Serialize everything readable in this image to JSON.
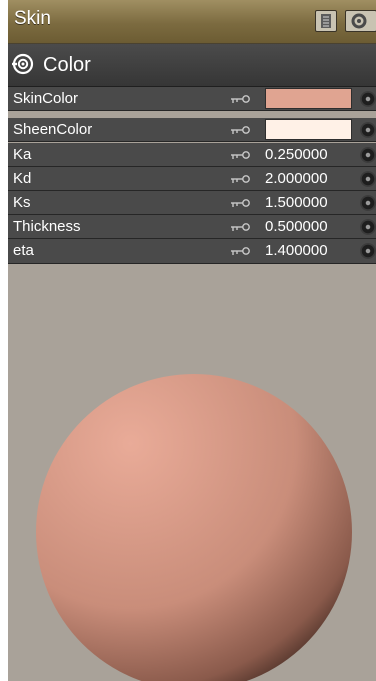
{
  "panel": {
    "title": "Skin",
    "toolbar": [
      {
        "name": "list-view-button",
        "icon": "list-icon"
      },
      {
        "name": "options-button",
        "icon": "gear-icon"
      }
    ]
  },
  "group": {
    "label": "Color",
    "icon": "collapse-toggle-icon"
  },
  "params": [
    {
      "label": "SkinColor",
      "type": "color",
      "color": "#e0a491"
    },
    {
      "label": "SheenColor",
      "type": "color",
      "color": "#fff1e7"
    },
    {
      "label": "Ka",
      "type": "number",
      "value": "0.250000"
    },
    {
      "label": "Kd",
      "type": "number",
      "value": "2.000000"
    },
    {
      "label": "Ks",
      "type": "number",
      "value": "1.500000"
    },
    {
      "label": "Thickness",
      "type": "number",
      "value": "0.500000"
    },
    {
      "label": "eta",
      "type": "number",
      "value": "1.400000"
    }
  ],
  "preview": {
    "background": "#a9a299",
    "sphere_highlight": "#e9ab98",
    "sphere_base": "#c98d7a",
    "sphere_shadow": "#1a0f0b"
  }
}
